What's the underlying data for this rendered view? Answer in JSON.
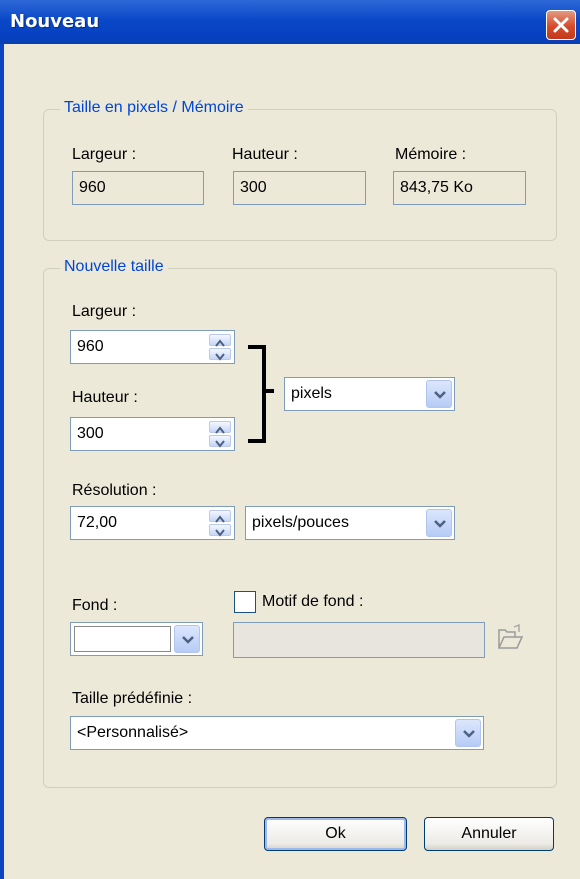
{
  "window": {
    "title": "Nouveau"
  },
  "memory_group": {
    "legend": "Taille en pixels / Mémoire",
    "width_label": "Largeur :",
    "width_value": "960",
    "height_label": "Hauteur :",
    "height_value": "300",
    "memory_label": "Mémoire :",
    "memory_value": "843,75 Ko"
  },
  "new_size_group": {
    "legend": "Nouvelle taille",
    "width_label": "Largeur :",
    "width_value": "960",
    "height_label": "Hauteur :",
    "height_value": "300",
    "unit_selected": "pixels",
    "resolution_label": "Résolution :",
    "resolution_value": "72,00",
    "resolution_unit_selected": "pixels/pouces",
    "background_label": "Fond :",
    "background_color": "#ffffff",
    "pattern_checkbox_label": "Motif de fond :",
    "pattern_checked": false,
    "pattern_value": "",
    "preset_label": "Taille prédéfinie :",
    "preset_selected": "<Personnalisé>"
  },
  "buttons": {
    "ok": "Ok",
    "cancel": "Annuler"
  },
  "colors": {
    "titlebar": "#0a48c8",
    "legend_text": "#0046d5",
    "dialog_bg": "#ece9d8"
  },
  "icons": {
    "close": "close-icon",
    "browse": "folder-open-icon",
    "spin": "spin-arrows-icon",
    "dropdown": "chevron-down-icon"
  }
}
